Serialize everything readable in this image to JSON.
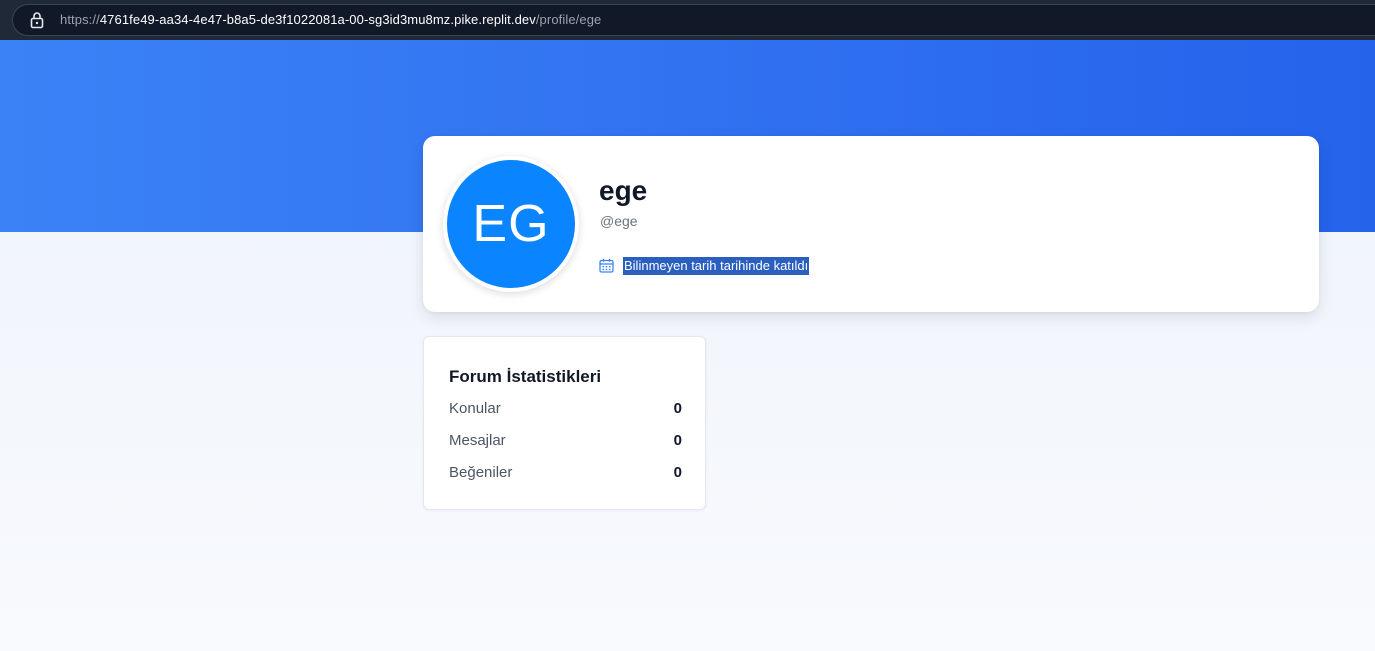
{
  "browser": {
    "url_prefix": "https://",
    "url_host": "4761fe49-aa34-4e47-b8a5-de3f1022081a-00-sg3id3mu8mz.pike.replit.dev",
    "url_path": "/profile/ege"
  },
  "profile": {
    "avatar_initials": "EG",
    "display_name": "ege",
    "username": "@ege",
    "joined_text": "Bilinmeyen tarih tarihinde katıldı"
  },
  "stats": {
    "title": "Forum İstatistikleri",
    "rows": [
      {
        "label": "Konular",
        "value": "0"
      },
      {
        "label": "Mesajlar",
        "value": "0"
      },
      {
        "label": "Beğeniler",
        "value": "0"
      }
    ]
  },
  "icons": {
    "lock": "lock-icon",
    "calendar": "calendar-icon"
  },
  "colors": {
    "banner_start": "#3b82f6",
    "banner_end": "#2563eb",
    "avatar_bg": "#0a84ff",
    "selection_highlight": "#2a5fc0"
  }
}
